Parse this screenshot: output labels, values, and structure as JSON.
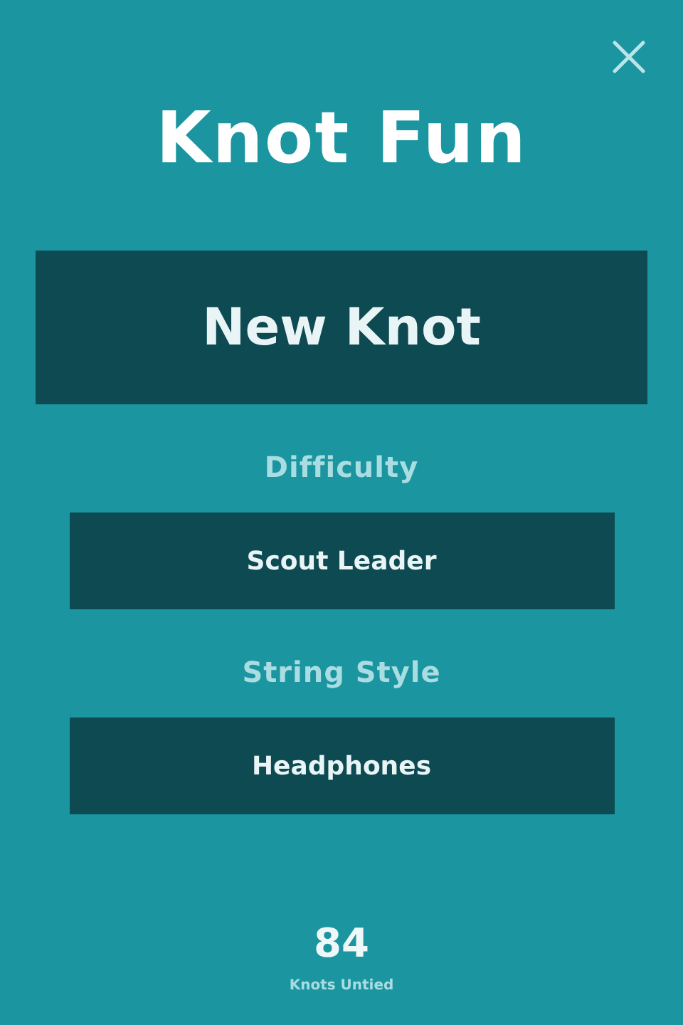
{
  "title": "Knot Fun",
  "new_button": "New Knot",
  "settings": [
    {
      "label": "Difficulty",
      "value": "Scout Leader"
    },
    {
      "label": "String Style",
      "value": "Headphones"
    }
  ],
  "stats": {
    "count": "84",
    "caption": "Knots Untied"
  }
}
